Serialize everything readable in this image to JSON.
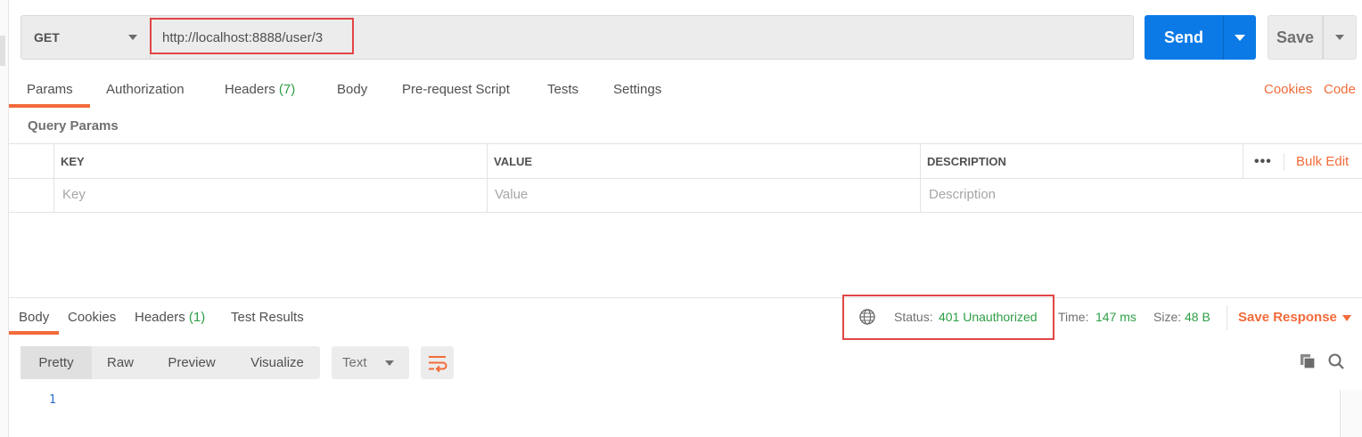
{
  "request": {
    "method": "GET",
    "url": "http://localhost:8888/user/3",
    "send_label": "Send",
    "save_label": "Save"
  },
  "request_tabs": {
    "params": "Params",
    "authorization": "Authorization",
    "headers": "Headers",
    "headers_count": "(7)",
    "body": "Body",
    "prerequest": "Pre-request Script",
    "tests": "Tests",
    "settings": "Settings",
    "cookies": "Cookies",
    "code": "Code"
  },
  "query_params": {
    "title": "Query Params",
    "columns": [
      "KEY",
      "VALUE",
      "DESCRIPTION"
    ],
    "placeholders": [
      "Key",
      "Value",
      "Description"
    ],
    "bulk_edit": "Bulk Edit",
    "more": "•••"
  },
  "response": {
    "tabs": {
      "body": "Body",
      "cookies": "Cookies",
      "headers": "Headers",
      "headers_count": "(1)",
      "test_results": "Test Results"
    },
    "status_label": "Status:",
    "status_value": "401 Unauthorized",
    "time_label": "Time:",
    "time_value": "147 ms",
    "size_label": "Size:",
    "size_value": "48 B",
    "save_response": "Save Response",
    "views": [
      "Pretty",
      "Raw",
      "Preview",
      "Visualize"
    ],
    "format": "Text",
    "line_number": "1"
  },
  "colors": {
    "accent": "#f26b3a",
    "send_blue": "#0b7ae6",
    "success_green": "#2e9e45",
    "highlight_red": "#e34545"
  }
}
